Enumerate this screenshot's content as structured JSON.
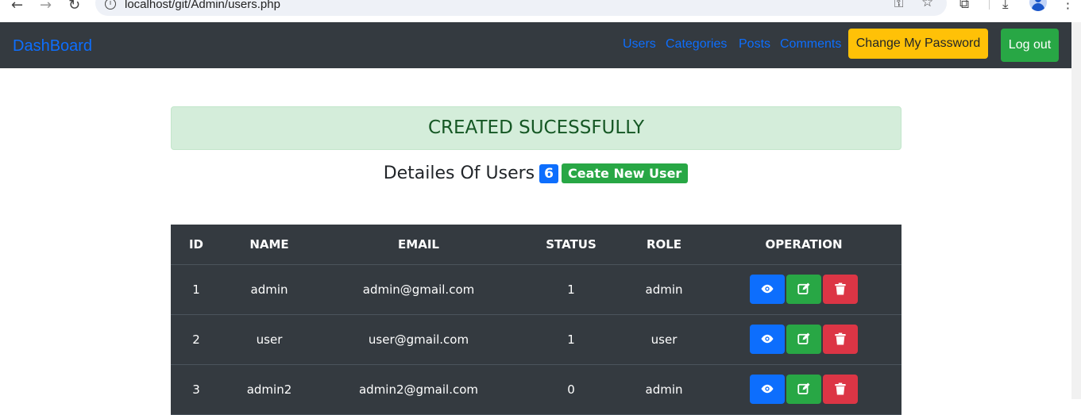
{
  "browser": {
    "url": "localhost/git/Admin/users.php"
  },
  "navbar": {
    "brand": "DashBoard",
    "links": [
      "Users",
      "Categories",
      "Posts",
      "Comments"
    ],
    "change_password_label": "Change My Password",
    "logout_label": "Log out"
  },
  "alert": {
    "message": "CREATED SUCESSFULLY"
  },
  "heading": {
    "title": "Detailes Of Users",
    "count": "6",
    "create_label": "Ceate New User"
  },
  "table": {
    "headers": [
      "ID",
      "NAME",
      "EMAIL",
      "STATUS",
      "ROLE",
      "OPERATION"
    ],
    "rows": [
      {
        "id": "1",
        "name": "admin",
        "email": "admin@gmail.com",
        "status": "1",
        "role": "admin"
      },
      {
        "id": "2",
        "name": "user",
        "email": "user@gmail.com",
        "status": "1",
        "role": "user"
      },
      {
        "id": "3",
        "name": "admin2",
        "email": "admin2@gmail.com",
        "status": "0",
        "role": "admin"
      }
    ]
  },
  "icons": {
    "view": "eye-icon",
    "edit": "edit-icon",
    "delete": "trash-icon"
  },
  "colors": {
    "primary": "#0d6efd",
    "success": "#28a745",
    "danger": "#dc3545",
    "warning": "#ffc107",
    "dark": "#343a40",
    "alert_bg": "#d4edda",
    "alert_text": "#155724"
  }
}
